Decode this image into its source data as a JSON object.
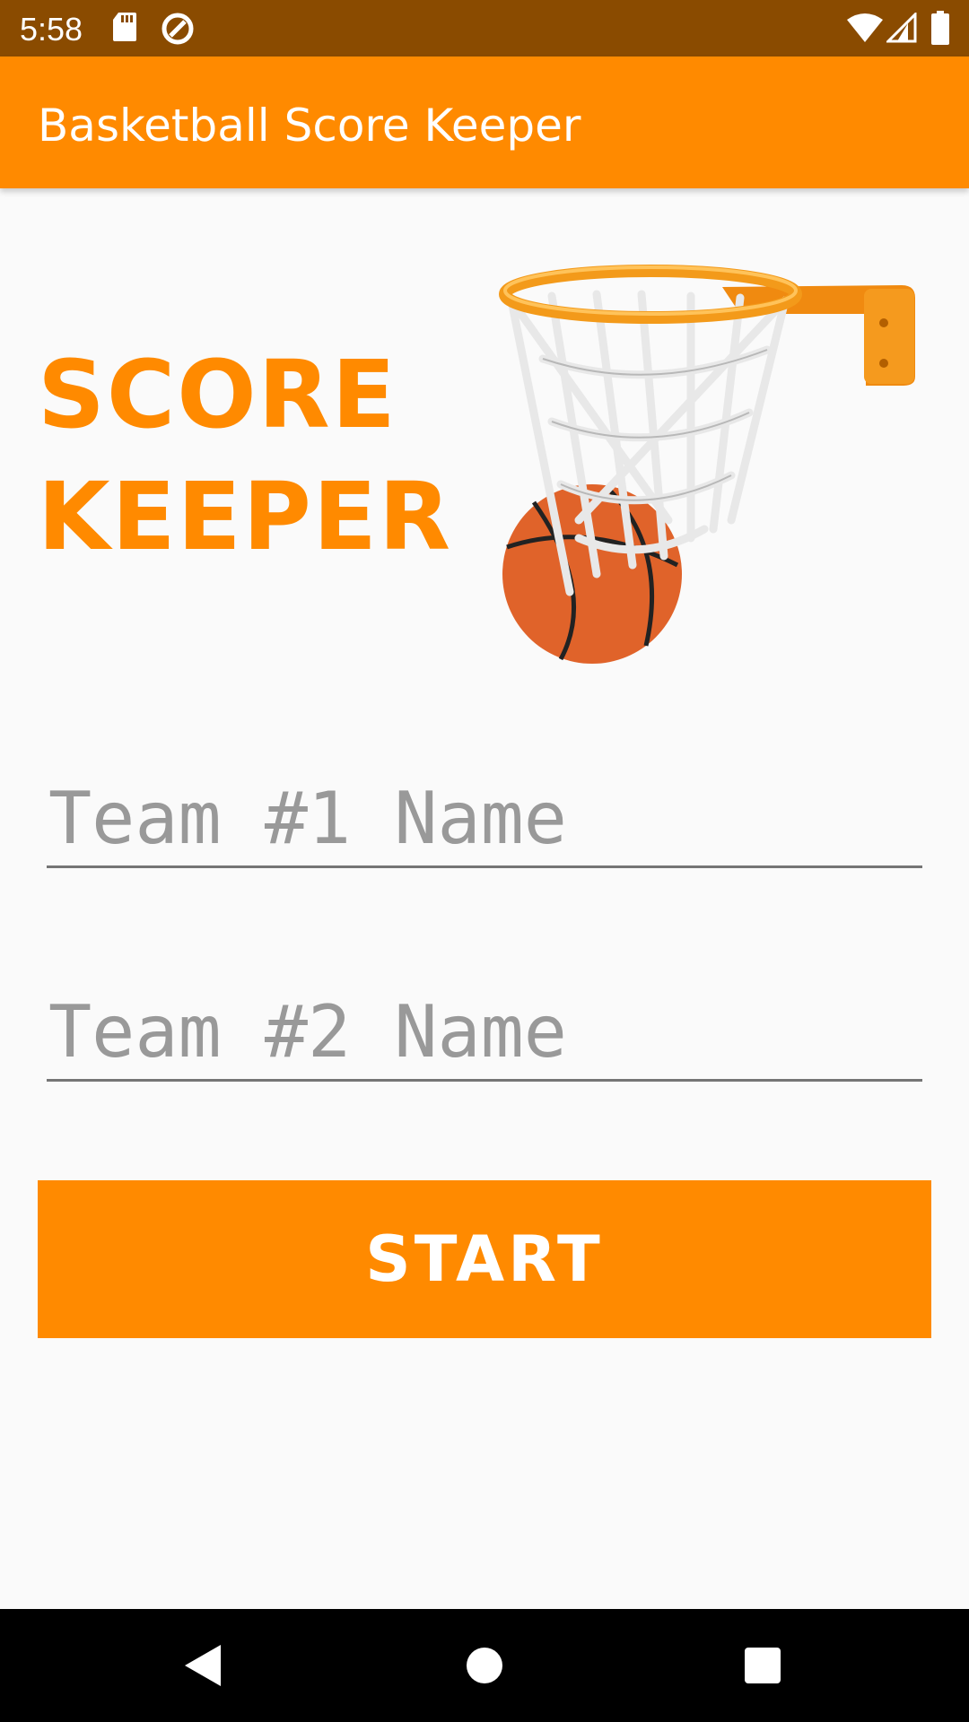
{
  "status_bar": {
    "time": "5:58",
    "icons": [
      "sd-card-icon",
      "data-saver-icon",
      "wifi-icon",
      "cell-signal-icon",
      "battery-icon"
    ]
  },
  "app_bar": {
    "title": "Basketball Score Keeper",
    "color": "#ff8a00"
  },
  "main": {
    "headline_line1": "SCORE",
    "headline_line2": "KEEPER",
    "image": "basketball-hoop-illustration",
    "team1": {
      "placeholder": "Team #1 Name",
      "value": ""
    },
    "team2": {
      "placeholder": "Team #2 Name",
      "value": ""
    },
    "start_label": "START"
  },
  "nav_bar": {
    "icons": [
      "back-icon",
      "home-icon",
      "recents-icon"
    ]
  },
  "colors": {
    "accent": "#ff8a00",
    "status_bar": "#8a4b00",
    "background": "#fafafa"
  }
}
